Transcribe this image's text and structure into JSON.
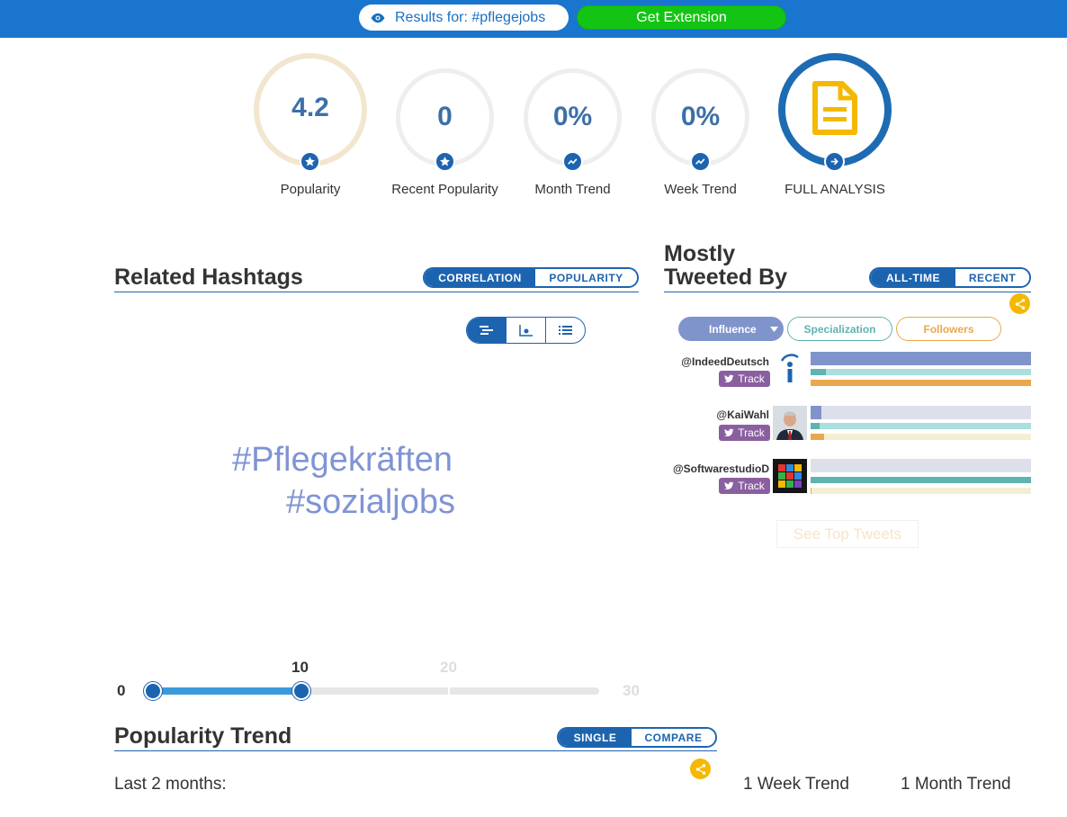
{
  "topbar": {
    "results_label": "Results for: #pflegejobs",
    "extension_label": "Get Extension",
    "colors": {
      "bar": "#1a75cf",
      "extension": "#14c414"
    }
  },
  "stats": [
    {
      "value": "4.2",
      "label": "Popularity",
      "badge_icon": "star-icon",
      "level": 0.04
    },
    {
      "value": "0",
      "label": "Recent Popularity",
      "badge_icon": "star-icon",
      "level": 0
    },
    {
      "value": "0%",
      "label": "Month Trend",
      "badge_icon": "trend-icon",
      "level": 0
    },
    {
      "value": "0%",
      "label": "Week Trend",
      "badge_icon": "trend-icon",
      "level": 0
    },
    {
      "value": "",
      "label": "FULL ANALYSIS",
      "badge_icon": "arrow-right-icon",
      "icon": "document-icon"
    }
  ],
  "related": {
    "title": "Related Hashtags",
    "tabs": [
      {
        "label": "CORRELATION",
        "active": true
      },
      {
        "label": "POPULARITY",
        "active": false
      }
    ],
    "views": [
      "cloud-view-icon",
      "scatter-view-icon",
      "list-view-icon"
    ],
    "words": [
      "#Pflegekräften",
      "#sozialjobs"
    ],
    "slider": {
      "min": "0",
      "low": "10",
      "mid": "20",
      "max": "30",
      "value_low": 0,
      "value_high": 10
    }
  },
  "tweeted_by": {
    "title_line1": "Mostly",
    "title_line2": "Tweeted By",
    "tabs": [
      {
        "label": "ALL-TIME",
        "active": true
      },
      {
        "label": "RECENT",
        "active": false
      }
    ],
    "filters": [
      "Influence",
      "Specialization",
      "Followers"
    ],
    "track_label": "Track",
    "users": [
      {
        "handle": "@IndeedDeutsch",
        "influence": 1.0,
        "specialization": 0.07,
        "followers": 1.0
      },
      {
        "handle": "@KaiWahl",
        "influence": 0.05,
        "specialization": 0.04,
        "followers": 0.06
      },
      {
        "handle": "@SoftwarestudioD",
        "influence": 0.0,
        "specialization": 1.0,
        "followers": 0.005
      }
    ],
    "see_top": "See Top Tweets",
    "colors": {
      "influence": "#8094cc",
      "specialization": "#5fb3b0",
      "followers": "#e8a84c"
    }
  },
  "popularity_trend": {
    "title": "Popularity Trend",
    "tabs": [
      {
        "label": "SINGLE",
        "active": true
      },
      {
        "label": "COMPARE",
        "active": false
      }
    ],
    "last_label": "Last 2 months:",
    "week_label": "1 Week Trend",
    "month_label": "1 Month Trend"
  }
}
